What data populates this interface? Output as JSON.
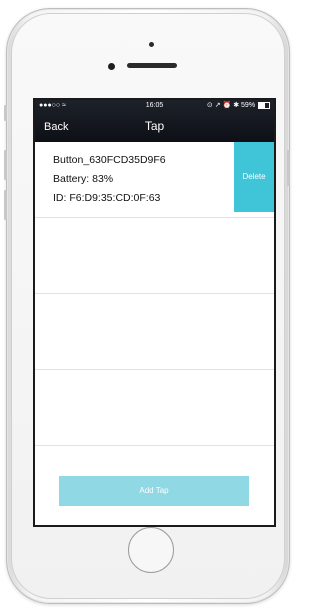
{
  "status_bar": {
    "carrier_dots": "●●●○○",
    "wifi": "≈",
    "time": "16:05",
    "right_icons": "⊙ ↗ ⏰ ✱",
    "battery_percent": "59%",
    "battery_level": 0.59
  },
  "nav": {
    "back_label": "Back",
    "title": "Tap"
  },
  "devices": [
    {
      "name": "Button_630FCD35D9F6",
      "battery": "Battery: 83%",
      "id": "ID: F6:D9:35:CD:0F:63",
      "delete_label": "Delete"
    }
  ],
  "add_button_label": "Add Tap",
  "colors": {
    "accent": "#3fc4d8",
    "accent_light": "#8fd8e4",
    "navbar": "#12161d"
  }
}
